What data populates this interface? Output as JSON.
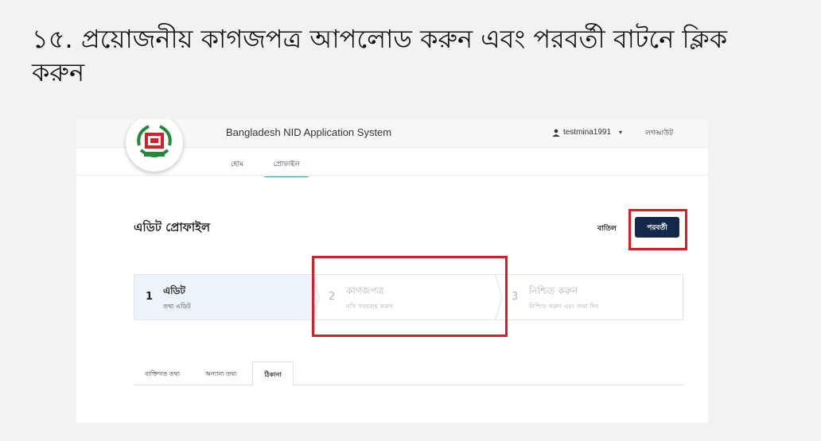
{
  "instruction": {
    "line1": "১৫. প্রয়োজনীয় কাগজপত্র আপলোড করুন এবং পরবর্তী বাটনে ক্লিক",
    "line2": "করুন"
  },
  "app": {
    "title": "Bangladesh NID Application System",
    "username": "testmina1991",
    "logout_label": "লগআউট"
  },
  "nav": {
    "home": "হোম",
    "profile": "প্রোফাইল"
  },
  "page": {
    "title": "এডিট প্রোফাইল",
    "cancel_label": "বাতিল",
    "next_label": "পরবর্তী"
  },
  "steps": [
    {
      "num": "1",
      "title": "এডিট",
      "subtitle": "তথ্য এডিট"
    },
    {
      "num": "2",
      "title": "কাগজপত্র",
      "subtitle": "নথি সরবরাহ করুন"
    },
    {
      "num": "3",
      "title": "নিশ্চিত করুন",
      "subtitle": "নিশ্চিত করুন এবং জমা দিন"
    }
  ],
  "tabs": {
    "personal": "ব্যক্তিগত তথ্য",
    "other": "অন্যান্য তথ্য",
    "address": "ঠিকানা"
  },
  "colors": {
    "accent": "#14284b",
    "highlight": "#d42127",
    "active_tab_underline": "#2aa38f"
  }
}
